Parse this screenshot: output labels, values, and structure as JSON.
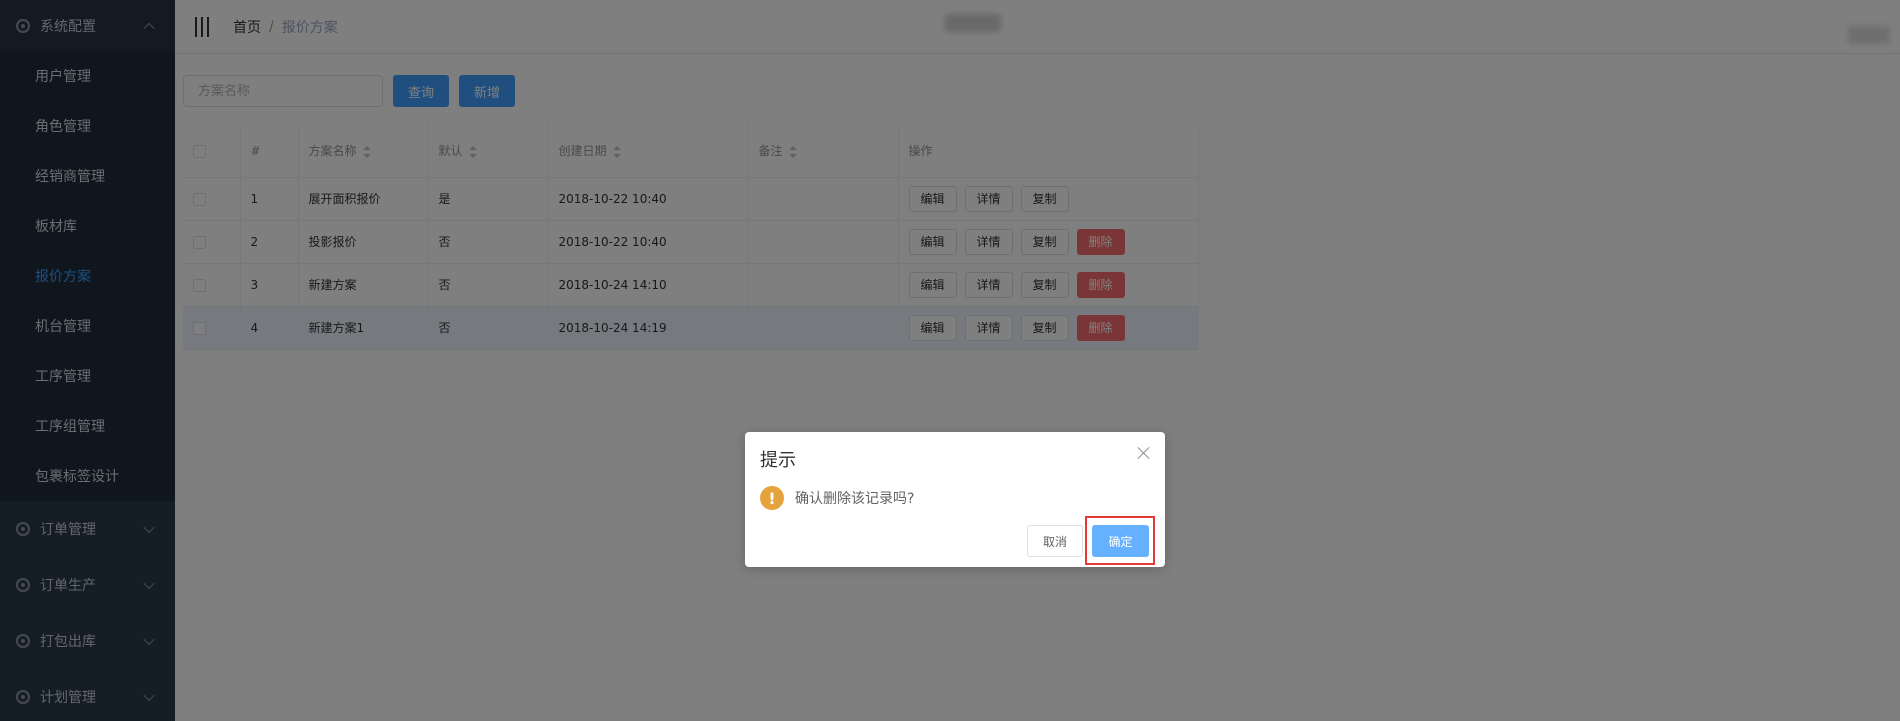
{
  "sidebar": {
    "open_group": {
      "label": "系统配置",
      "icon": "gear-icon"
    },
    "subitems": [
      {
        "label": "用户管理",
        "active": false
      },
      {
        "label": "角色管理",
        "active": false
      },
      {
        "label": "经销商管理",
        "active": false
      },
      {
        "label": "板材库",
        "active": false
      },
      {
        "label": "报价方案",
        "active": true
      },
      {
        "label": "机台管理",
        "active": false
      },
      {
        "label": "工序管理",
        "active": false
      },
      {
        "label": "工序组管理",
        "active": false
      },
      {
        "label": "包裹标签设计",
        "active": false
      }
    ],
    "groups": [
      {
        "label": "订单管理"
      },
      {
        "label": "订单生产"
      },
      {
        "label": "打包出库"
      },
      {
        "label": "计划管理"
      }
    ]
  },
  "header": {
    "breadcrumb_home": "首页",
    "breadcrumb_sep": "/",
    "breadcrumb_current": "报价方案"
  },
  "toolbar": {
    "search_placeholder": "方案名称",
    "query_label": "查询",
    "add_label": "新增"
  },
  "table": {
    "headers": {
      "index": "#",
      "name": "方案名称",
      "default": "默认",
      "created": "创建日期",
      "remark": "备注",
      "actions": "操作"
    },
    "rows": [
      {
        "index": "1",
        "name": "展开面积报价",
        "default": "是",
        "created": "2018-10-22 10:40",
        "remark": "",
        "deletable": false
      },
      {
        "index": "2",
        "name": "投影报价",
        "default": "否",
        "created": "2018-10-22 10:40",
        "remark": "",
        "deletable": true
      },
      {
        "index": "3",
        "name": "新建方案",
        "default": "否",
        "created": "2018-10-24 14:10",
        "remark": "",
        "deletable": true
      },
      {
        "index": "4",
        "name": "新建方案1",
        "default": "否",
        "created": "2018-10-24 14:19",
        "remark": "",
        "deletable": true
      }
    ],
    "action_labels": {
      "edit": "编辑",
      "detail": "详情",
      "copy": "复制",
      "delete": "删除"
    }
  },
  "dialog": {
    "title": "提示",
    "message": "确认删除该记录吗?",
    "warn_glyph": "!",
    "cancel_label": "取消",
    "confirm_label": "确定"
  },
  "colors": {
    "sidebar_bg": "#2b3a4d",
    "active": "#409eff",
    "danger": "#f56c6c",
    "warning": "#e6a23c"
  }
}
